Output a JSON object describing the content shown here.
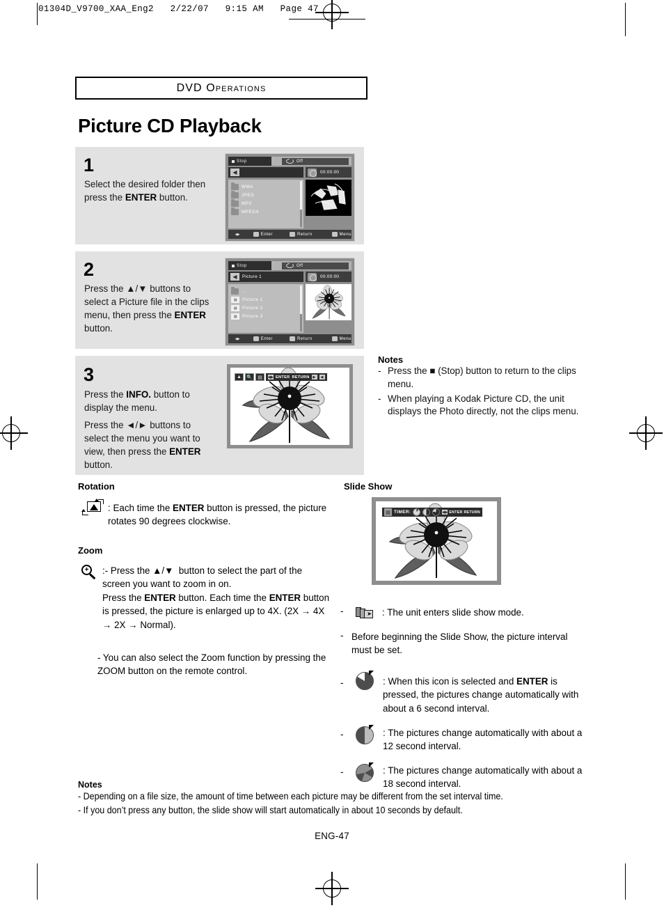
{
  "doc_header": "01304D_V9700_XAA_Eng2   2/22/07   9:15 AM   Page 47",
  "banner": {
    "label": "DVD Operations"
  },
  "page_title": "Picture CD Playback",
  "steps": [
    {
      "number": "1",
      "text_html": "Select the desired folder then press the <b>ENTER</b> button.",
      "screen": {
        "status": "Stop",
        "repeat": "Off",
        "file_label": "",
        "time": "00:00:00",
        "files": [
          "WMA",
          "JPEG",
          "MP3",
          "MPEG4"
        ],
        "bottom": {
          "enter": "Enter",
          "return": "Return",
          "menu": "Menu"
        }
      }
    },
    {
      "number": "2",
      "text_html": "Press the ▲/▼ buttons to select a Picture file in the clips menu, then press the <b>ENTER</b> button.",
      "screen": {
        "status": "Stop",
        "repeat": "Off",
        "file_label": "Picture 1",
        "time": "00:00:00",
        "parent": "...",
        "files": [
          "Picture 1",
          "Picture 2",
          "Picture 3"
        ],
        "bottom": {
          "enter": "Enter",
          "return": "Return",
          "menu": "Menu"
        }
      }
    },
    {
      "number": "3",
      "text_html": "Press the <b>INFO.</b> button to display the menu.",
      "text2_html": "Press the ◄/► buttons to select the menu you want to view, then press the <b>ENTER</b> button.",
      "photo_menu": {
        "enter": "ENTER",
        "return": "RETURN"
      }
    }
  ],
  "side_notes": {
    "title": "Notes",
    "items_html": [
      "Press the ■ (Stop) button to return to the clips menu.",
      "When playing a Kodak Picture CD, the unit displays the Photo directly, not the clips menu."
    ]
  },
  "rotation": {
    "heading": "Rotation",
    "text_html": ": Each time the <b>ENTER</b> button is pressed, the picture rotates 90 degrees clockwise."
  },
  "zoom": {
    "heading": "Zoom",
    "text_html": ":- Press the ▲/▼&nbsp; button to select the part of the screen you want to zoom in on.<br>Press the <b>ENTER</b> button. Each time the <b>ENTER</b> button is pressed, the picture is enlarged up to 4X. (2X → 4X → 2X → Normal).",
    "extra_html": "- You can also select the Zoom function by pressing the ZOOM button on the remote control."
  },
  "slideshow": {
    "heading": "Slide Show",
    "screen": {
      "timer_label": "TIMER:",
      "enter": "ENTER",
      "return": "RETURN"
    },
    "bullets": [
      {
        "icon": "slideshow-icon",
        "text_html": ": The unit enters slide show mode."
      },
      {
        "icon": "none",
        "text_html": "Before beginning the Slide Show, the picture interval must be set."
      },
      {
        "icon": "pie-6s",
        "text_html": ": When this icon is selected and <b>ENTER</b> is pressed, the pictures change automatically with about a 6 second interval."
      },
      {
        "icon": "pie-12s",
        "text_html": ": The pictures change automatically with about a 12 second interval."
      },
      {
        "icon": "pie-18s",
        "text_html": ": The pictures change automatically with about a 18 second interval."
      }
    ]
  },
  "bottom_notes": {
    "title": "Notes",
    "lines": [
      "-  Depending on a file size, the amount of time between each picture may be different from the set interval time.",
      "- If you don’t press any button, the slide show will start automatically in about 10 seconds by default."
    ]
  },
  "folio": "ENG-47"
}
